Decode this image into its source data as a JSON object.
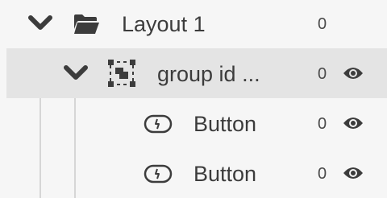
{
  "layers": [
    {
      "label": "Layout 1",
      "count": "0",
      "icon": "folder-open-icon",
      "expanded": true
    },
    {
      "label": "group id ...",
      "count": "0",
      "icon": "group-icon",
      "expanded": true,
      "selected": true,
      "visible": true
    },
    {
      "label": "Button",
      "count": "0",
      "icon": "button-component-icon",
      "visible": true
    },
    {
      "label": "Button",
      "count": "0",
      "icon": "button-component-icon",
      "visible": true
    }
  ],
  "colors": {
    "background": "#f6f6f6",
    "selected_row": "#e4e4e4",
    "icon": "#3c3c3c",
    "guide_line": "#d6d6d6"
  }
}
